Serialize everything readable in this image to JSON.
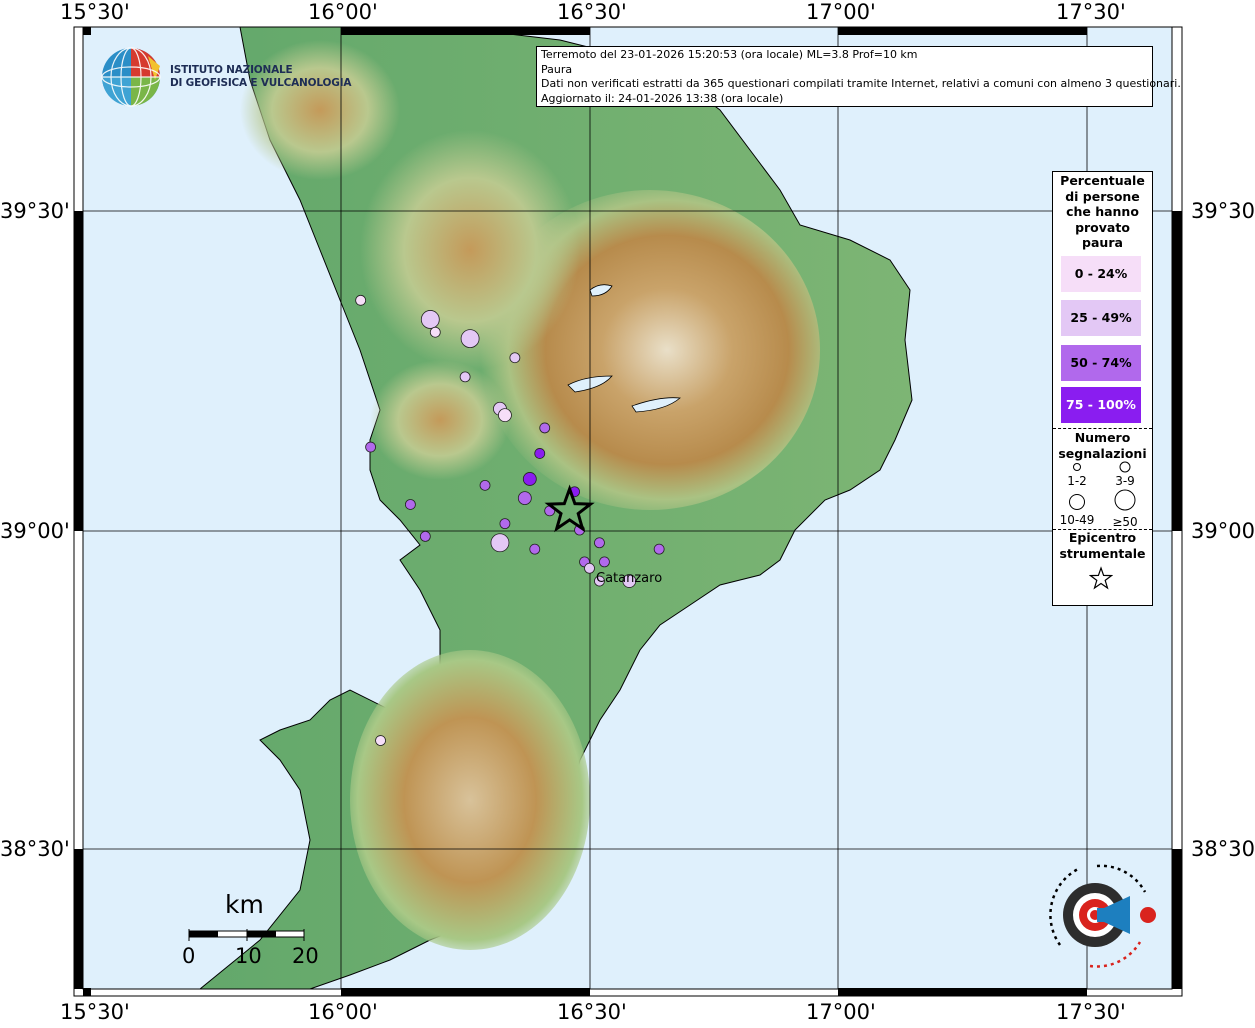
{
  "map": {
    "lon_ticks": [
      "15°30'",
      "16°00'",
      "16°30'",
      "17°00'",
      "17°30'"
    ],
    "lat_ticks": [
      "39°30'",
      "39°00'",
      "38°30'"
    ],
    "colors": {
      "sea": "#dff0fc",
      "land_low": "#4f9e62",
      "land_mid": "#a8c886",
      "land_high": "#b58b4a",
      "land_peak": "#ece3d0"
    }
  },
  "header": {
    "institute_line1": "ISTITUTO NAZIONALE",
    "institute_line2": "DI GEOFISICA E VULCANOLOGIA"
  },
  "info": {
    "line1": "Terremoto del 23-01-2026 15:20:53 (ora locale) ML=3.8 Prof=10 km",
    "line2": "Paura",
    "line3": "Dati non verificati estratti da 365 questionari compilati tramite Internet, relativi a comuni con almeno 3 questionari.",
    "line4": "Aggiornato il: 24-01-2026 13:38 (ora locale)"
  },
  "legend": {
    "title_lines": [
      "Percentuale",
      "di persone",
      "che hanno",
      "provato",
      "paura"
    ],
    "classes": [
      {
        "label": "0 - 24%",
        "color": "#f6def8"
      },
      {
        "label": "25 - 49%",
        "color": "#e3c8f5"
      },
      {
        "label": "50 - 74%",
        "color": "#b169ec"
      },
      {
        "label": "75 - 100%",
        "color": "#8a1df0"
      }
    ],
    "size_title_lines": [
      "Numero",
      "segnalazioni"
    ],
    "size_labels": [
      "1-2",
      "3-9",
      "10-49",
      "≥50"
    ],
    "epicenter_title_lines": [
      "Epicentro",
      "strumentale"
    ]
  },
  "places": {
    "city": "Catanzaro"
  },
  "scale": {
    "unit": "km",
    "labels": [
      "0",
      "10",
      "20"
    ]
  },
  "points": [
    {
      "lon": 16.04,
      "lat": 39.36,
      "pct": 0,
      "n": 1
    },
    {
      "lon": 16.18,
      "lat": 39.33,
      "pct": 1,
      "n": 3
    },
    {
      "lon": 16.19,
      "lat": 39.31,
      "pct": 0,
      "n": 1
    },
    {
      "lon": 16.26,
      "lat": 39.3,
      "pct": 1,
      "n": 3
    },
    {
      "lon": 16.35,
      "lat": 39.27,
      "pct": 1,
      "n": 1
    },
    {
      "lon": 16.25,
      "lat": 39.24,
      "pct": 1,
      "n": 1
    },
    {
      "lon": 16.32,
      "lat": 39.19,
      "pct": 1,
      "n": 2
    },
    {
      "lon": 16.33,
      "lat": 39.18,
      "pct": 0,
      "n": 2
    },
    {
      "lon": 16.41,
      "lat": 39.16,
      "pct": 2,
      "n": 1
    },
    {
      "lon": 16.06,
      "lat": 39.13,
      "pct": 2,
      "n": 1
    },
    {
      "lon": 16.4,
      "lat": 39.12,
      "pct": 3,
      "n": 1
    },
    {
      "lon": 16.38,
      "lat": 39.08,
      "pct": 3,
      "n": 2
    },
    {
      "lon": 16.29,
      "lat": 39.07,
      "pct": 2,
      "n": 1
    },
    {
      "lon": 16.14,
      "lat": 39.04,
      "pct": 2,
      "n": 1
    },
    {
      "lon": 16.37,
      "lat": 39.05,
      "pct": 2,
      "n": 2
    },
    {
      "lon": 16.47,
      "lat": 39.06,
      "pct": 3,
      "n": 1
    },
    {
      "lon": 16.33,
      "lat": 39.01,
      "pct": 2,
      "n": 1
    },
    {
      "lon": 16.48,
      "lat": 39.0,
      "pct": 2,
      "n": 1
    },
    {
      "lon": 16.42,
      "lat": 39.03,
      "pct": 2,
      "n": 1
    },
    {
      "lon": 16.17,
      "lat": 38.99,
      "pct": 2,
      "n": 1
    },
    {
      "lon": 16.32,
      "lat": 38.98,
      "pct": 1,
      "n": 3
    },
    {
      "lon": 16.39,
      "lat": 38.97,
      "pct": 2,
      "n": 1
    },
    {
      "lon": 16.52,
      "lat": 38.98,
      "pct": 2,
      "n": 1
    },
    {
      "lon": 16.64,
      "lat": 38.97,
      "pct": 2,
      "n": 1
    },
    {
      "lon": 16.49,
      "lat": 38.95,
      "pct": 2,
      "n": 1
    },
    {
      "lon": 16.53,
      "lat": 38.95,
      "pct": 2,
      "n": 1
    },
    {
      "lon": 16.5,
      "lat": 38.94,
      "pct": 1,
      "n": 1
    },
    {
      "lon": 16.52,
      "lat": 38.92,
      "pct": 1,
      "n": 1
    },
    {
      "lon": 16.58,
      "lat": 38.92,
      "pct": 1,
      "n": 2
    },
    {
      "lon": 16.08,
      "lat": 38.67,
      "pct": 0,
      "n": 1
    }
  ],
  "epicenter": {
    "lon": 16.46,
    "lat": 39.03
  }
}
